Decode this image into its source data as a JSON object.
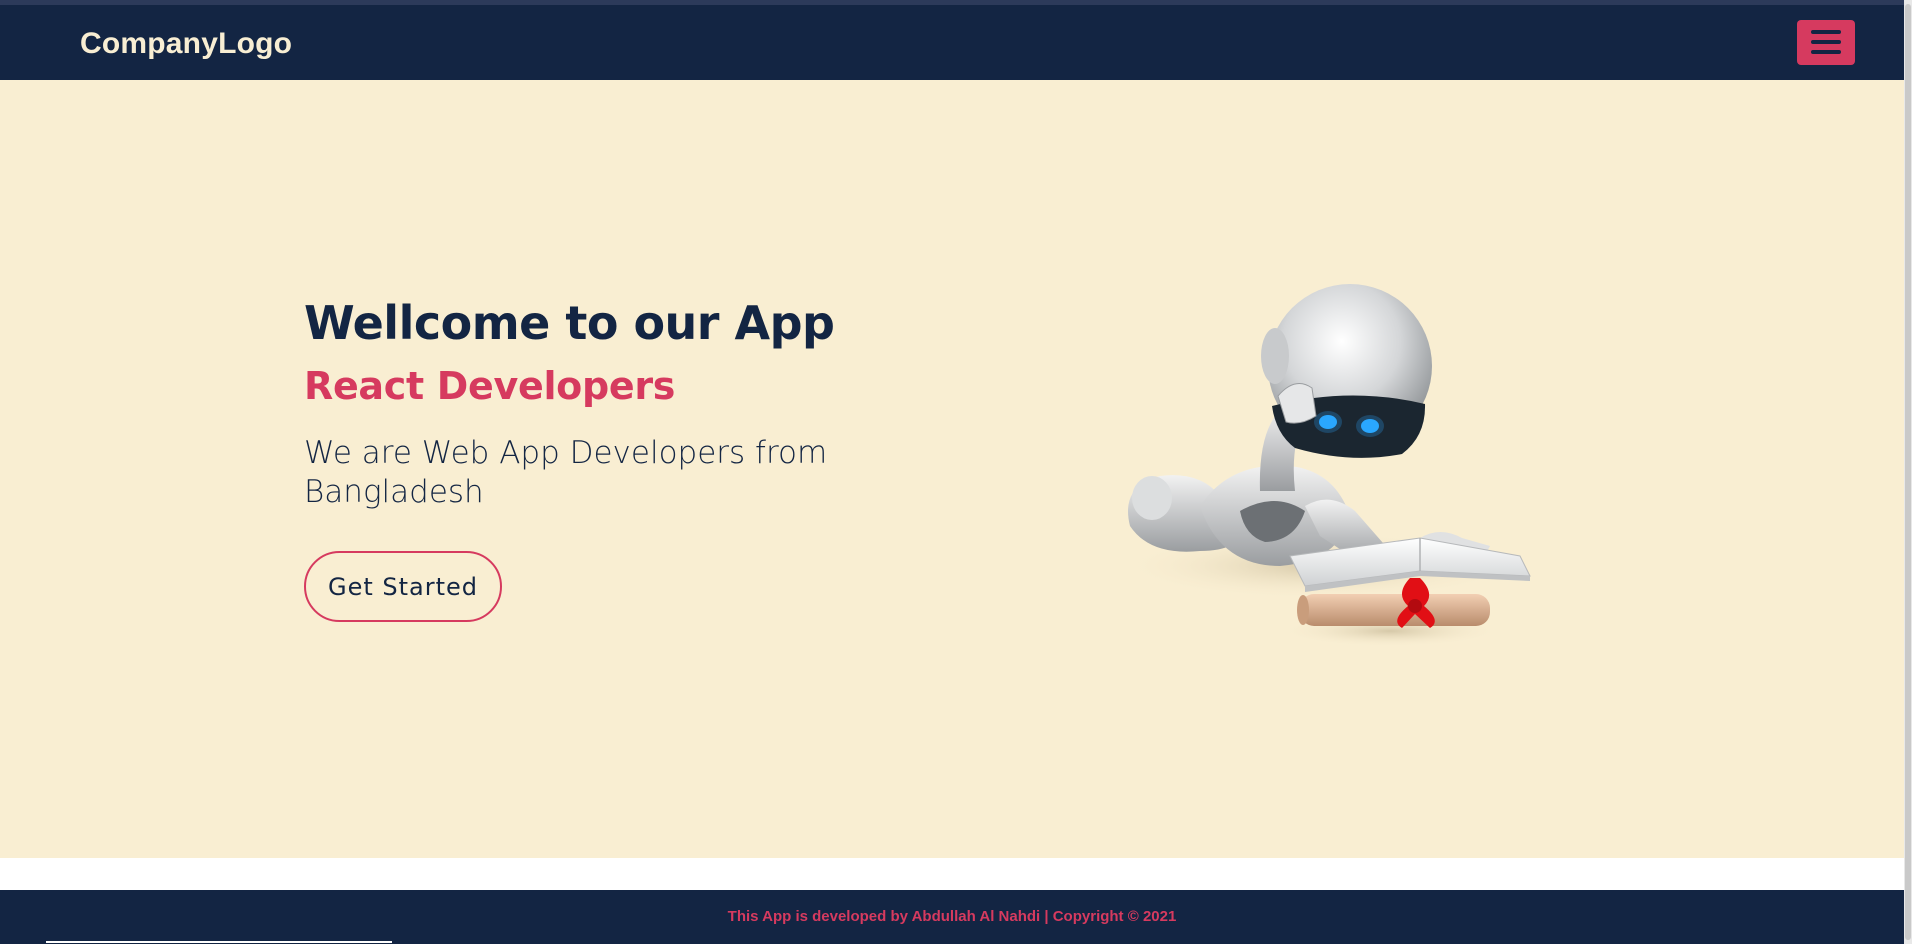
{
  "navbar": {
    "logo_text": "CompanyLogo",
    "menu_icon": "hamburger-menu-icon"
  },
  "hero": {
    "headline": "Wellcome to our App",
    "subheadline": "React Developers",
    "description": "We are Web App Developers from Bangladesh",
    "cta_label": "Get Started",
    "illustration": "robot-reading-book-illustration"
  },
  "footer": {
    "text": "This App is developed by Abdullah Al Nahdi | Copyright © 2021"
  },
  "colors": {
    "navy": "#132543",
    "accent": "#d63a5f",
    "cream": "#f9eed2"
  }
}
